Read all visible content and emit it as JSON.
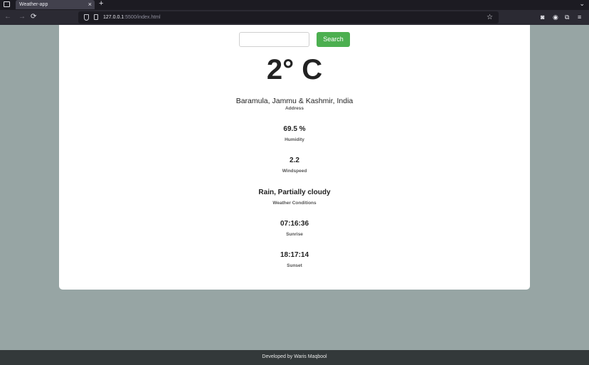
{
  "browser": {
    "tab_title": "Weather-app",
    "tab_close": "×",
    "new_tab": "+",
    "tabs_menu": "⌄",
    "url_host": "127.0.0.1",
    "url_rest": ":5500/index.html",
    "nav": {
      "back": "←",
      "forward": "→",
      "reload": "⟳"
    },
    "icons": {
      "star": "☆",
      "pocket": "◙",
      "account": "◉",
      "extensions": "⧉",
      "menu": "≡"
    }
  },
  "search": {
    "input_value": "",
    "button_label": "Search"
  },
  "weather": {
    "temperature": "2° C",
    "address": "Baramula, Jammu & Kashmir, India",
    "address_label": "Address",
    "humidity": "69.5 %",
    "humidity_label": "Humidity",
    "windspeed": "2.2",
    "windspeed_label": "Windspeed",
    "conditions": "Rain, Partially cloudy",
    "conditions_label": "Weather Conditions",
    "sunrise": "07:16:36",
    "sunrise_label": "Sunrise",
    "sunset": "18:17:14",
    "sunset_label": "Sunset"
  },
  "footer": {
    "text": "Developed by Waris Maqbool"
  },
  "colors": {
    "page_background": "#97a5a4",
    "search_button": "#4caf50",
    "footer_background": "#33393a"
  }
}
